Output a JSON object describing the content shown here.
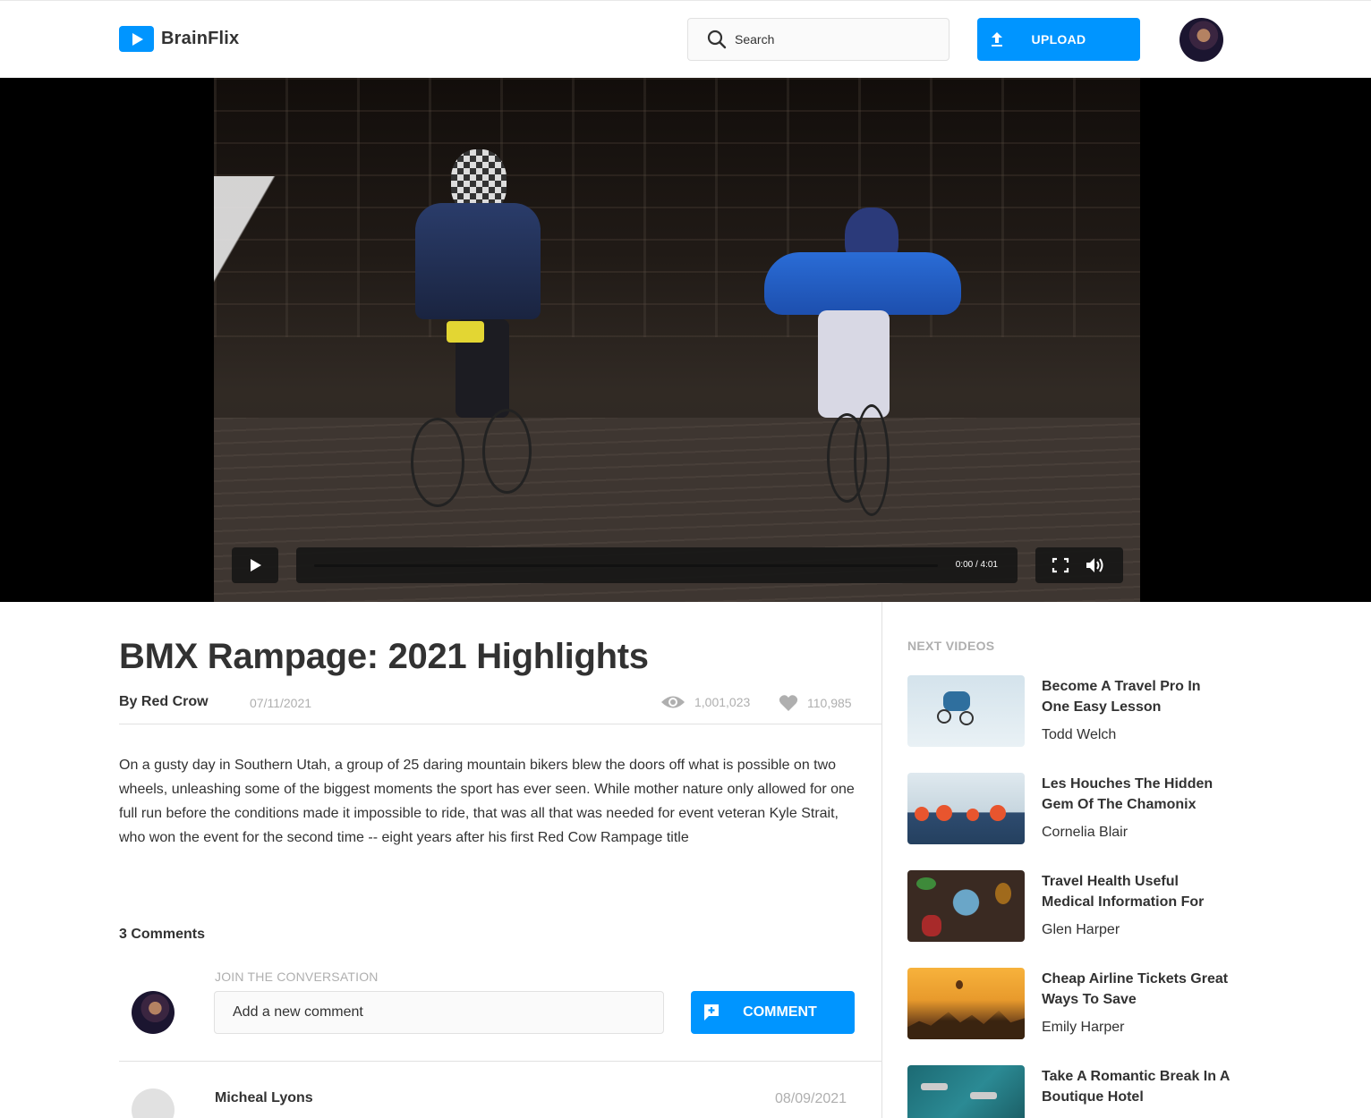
{
  "header": {
    "logo_text": "BrainFlix",
    "search_placeholder": "Search",
    "upload_label": "UPLOAD"
  },
  "video": {
    "time": "0:00 / 4:01",
    "progress": 0
  },
  "main": {
    "title": "BMX Rampage: 2021 Highlights",
    "byline": "By Red Crow",
    "date": "07/11/2021",
    "views": "1,001,023",
    "likes": "110,985",
    "description": "On a gusty day in Southern Utah, a group of 25 daring mountain bikers blew the doors off what is possible on two wheels, unleashing some of the biggest moments the sport has ever seen. While mother nature only allowed for one full run before the conditions made it impossible to ride, that was all that was needed for event veteran Kyle Strait, who won the event for the second time -- eight years after his first Red Cow Rampage title"
  },
  "comments": {
    "count_label": "3 Comments",
    "join_label": "JOIN THE CONVERSATION",
    "input_placeholder": "Add a new comment",
    "button_label": "COMMENT",
    "items": [
      {
        "name": "Micheal Lyons",
        "date": "08/09/2021"
      }
    ]
  },
  "sidebar": {
    "label": "NEXT VIDEOS",
    "items": [
      {
        "title": "Become A Travel Pro In One Easy Lesson",
        "author": "Todd Welch"
      },
      {
        "title": "Les Houches The Hidden Gem Of The Chamonix",
        "author": "Cornelia Blair"
      },
      {
        "title": "Travel Health Useful Medical Information For",
        "author": "Glen Harper"
      },
      {
        "title": "Cheap Airline Tickets Great Ways To Save",
        "author": "Emily Harper"
      },
      {
        "title": "Take A Romantic Break In A Boutique Hotel",
        "author": ""
      }
    ]
  },
  "colors": {
    "accent": "#0095ff",
    "text": "#323232",
    "muted": "#afafaf",
    "border": "#e1e1e1"
  }
}
